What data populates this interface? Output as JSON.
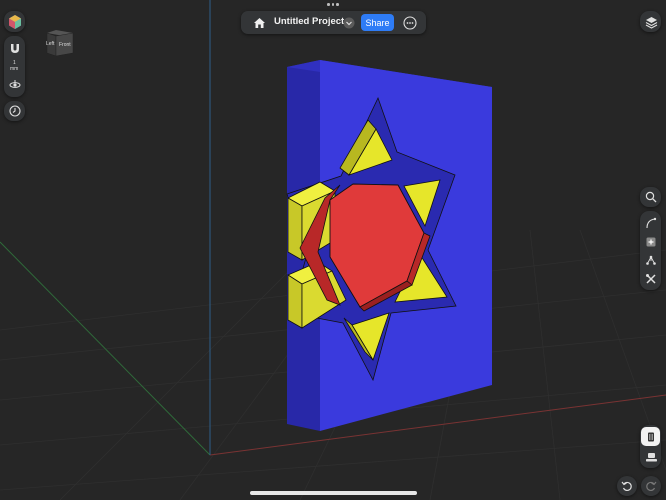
{
  "header": {
    "project_title": "Untitled Project",
    "share_label": "Share"
  },
  "view_cube": {
    "left_label": "Left",
    "front_label": "Front"
  },
  "left_toolbar": {
    "unit_value": "1",
    "unit_label": "mm"
  },
  "icons": {
    "home": "home-icon",
    "chevron": "chevron-down-icon",
    "more": "more-icon",
    "layers": "layers-icon",
    "search": "search-icon"
  },
  "model_colors": {
    "body_front": "#3838dc",
    "body_side": "#2626a8",
    "star_yellow": "#e6e62a",
    "hexagon_red": "#e03a3a",
    "outline_dark": "#1c1c6e"
  }
}
